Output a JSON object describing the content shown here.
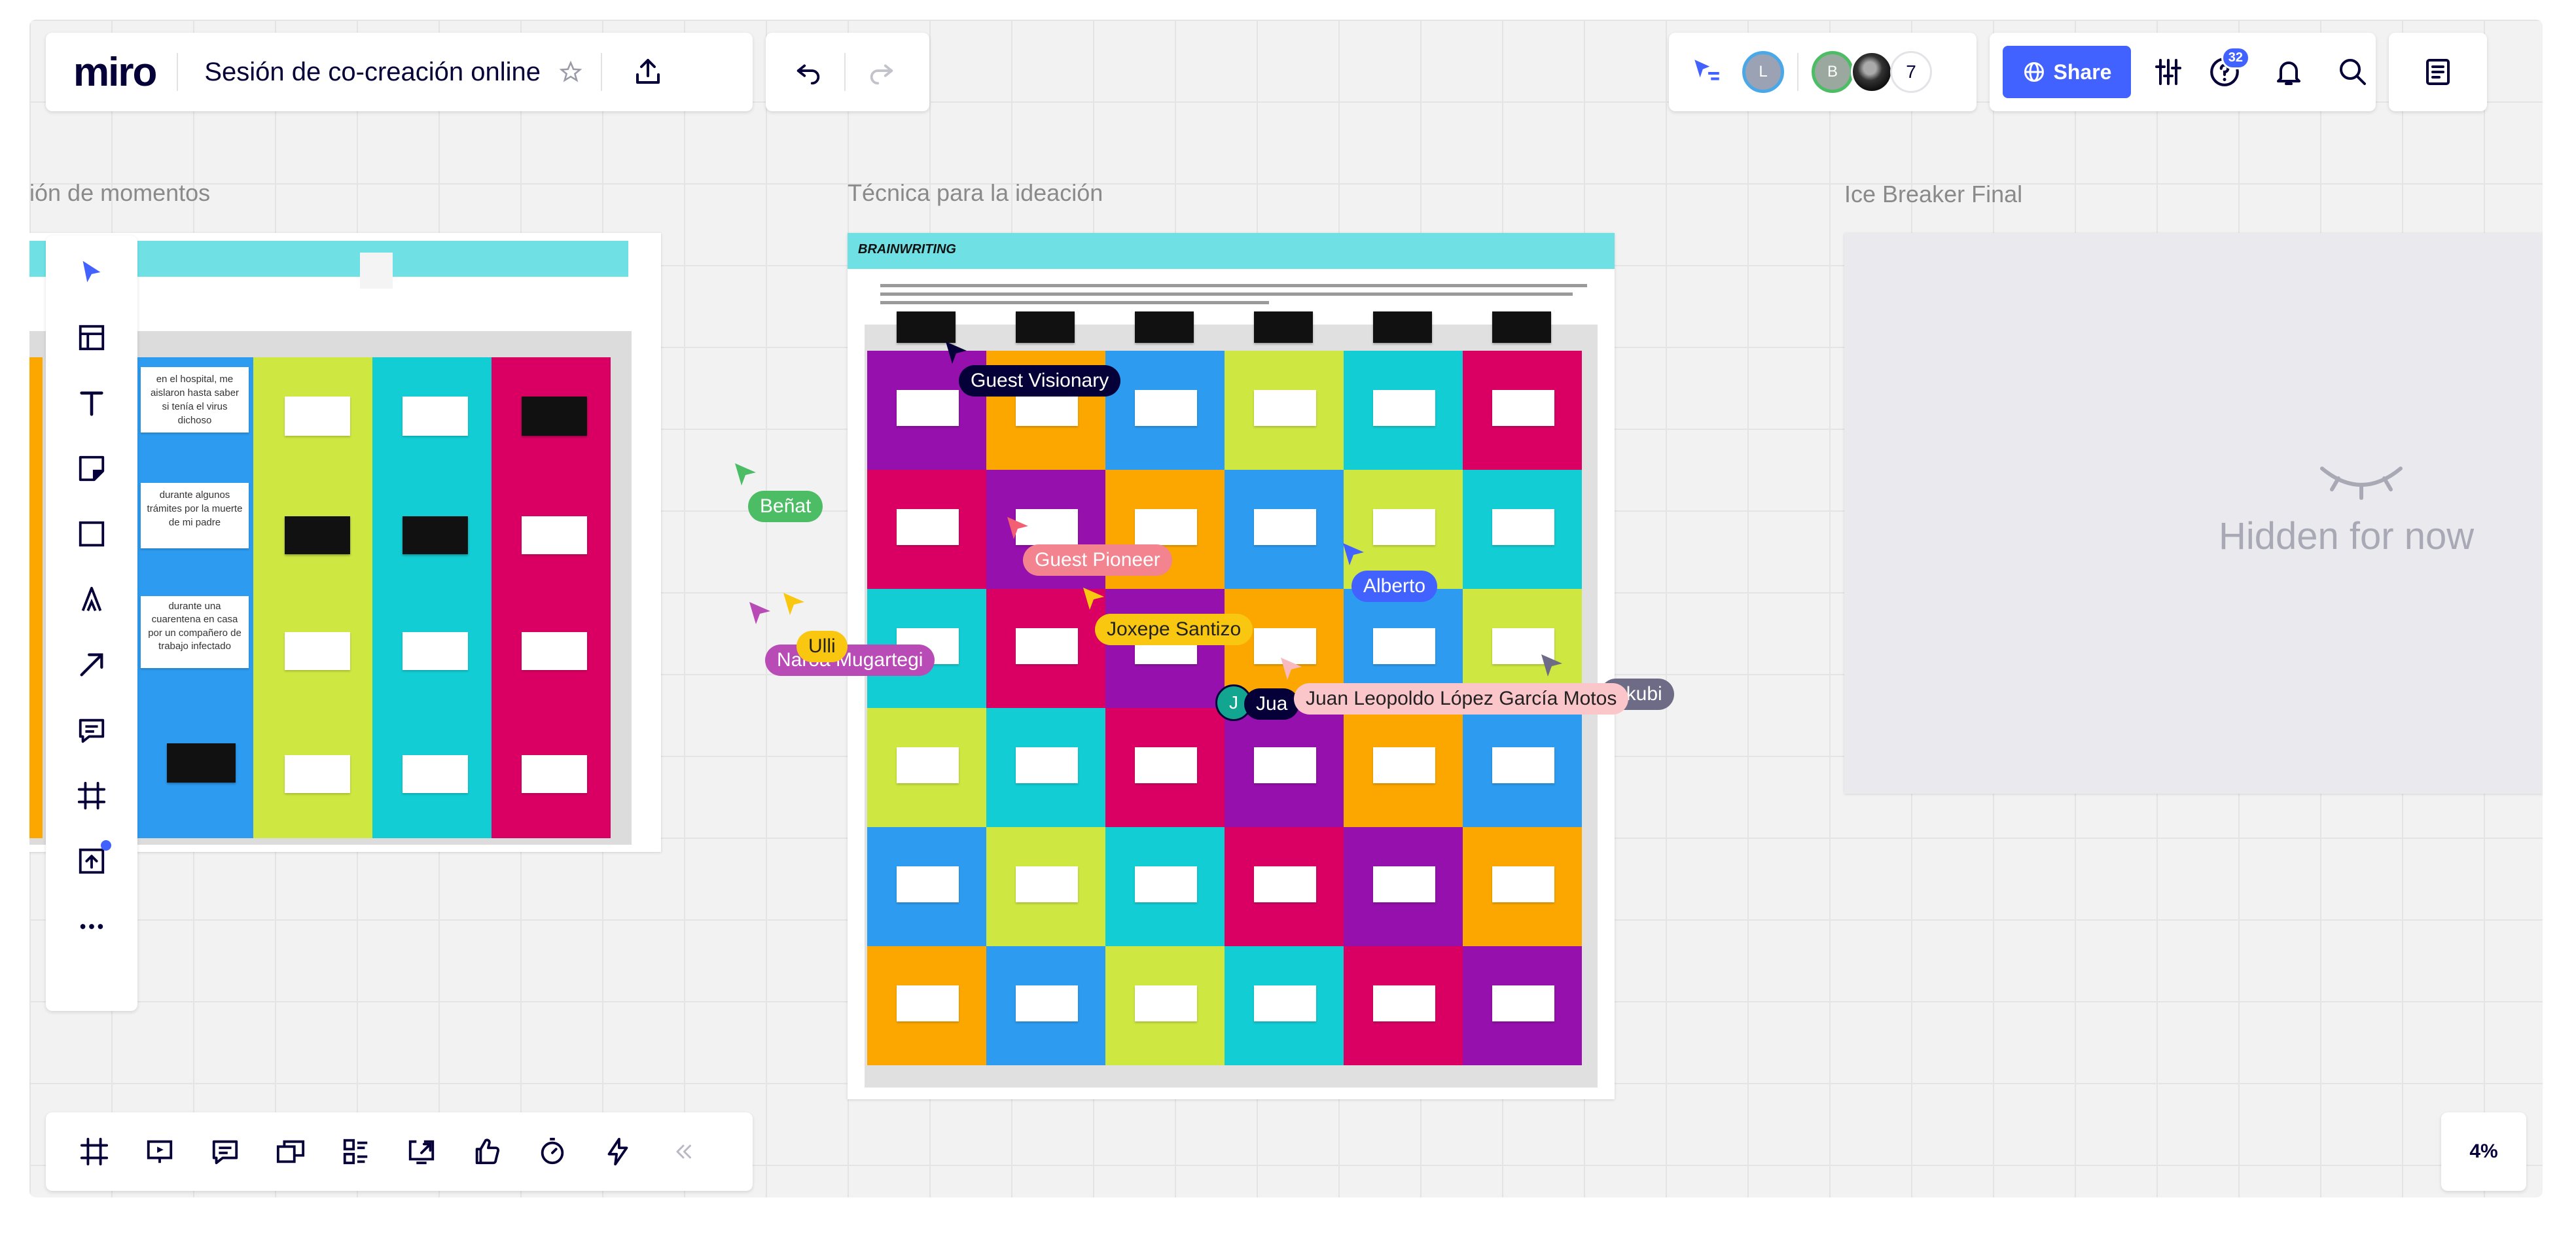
{
  "app": {
    "logo": "miro",
    "board_title": "Sesión de co-creación online"
  },
  "toolbar": {
    "participant_count": "7",
    "avatar_l": "L",
    "avatar_b": "B",
    "share_label": "Share",
    "notifications": "32"
  },
  "frames": {
    "left_title": "ión de momentos",
    "middle_title": "Técnica para la ideación",
    "right_title": "Ice Breaker Final",
    "hidden_label": "Hidden for now",
    "brainwriting_heading": "BRAINWRITING",
    "left_notes": [
      "en el hospital, me aislaron hasta saber si tenía el virus dichoso",
      "durante algunos trámites por la muerte de mi padre",
      "durante una cuarentena en casa por un compañero de trabajo infectado"
    ]
  },
  "cursors": {
    "visionary": "Guest Visionary",
    "benat": "Beñat",
    "pioneer": "Guest Pioneer",
    "alberto": "Alberto",
    "joxepe": "Joxepe Santizo",
    "ulli": "Ulli",
    "naroa": "Naroa Mugartegi",
    "juan_short": "Jua",
    "juan_full": "Juan Leopoldo López García Motos",
    "iskubi": "iskubi",
    "juan_avatar": "J"
  },
  "zoom": "4%",
  "colors": {
    "accent": "#4262ff",
    "purple": "#9510ac",
    "orange": "#fca700",
    "blue": "#2d9bf0",
    "lime": "#cee741",
    "cyan": "#12cdd4",
    "pink": "#da0063"
  }
}
